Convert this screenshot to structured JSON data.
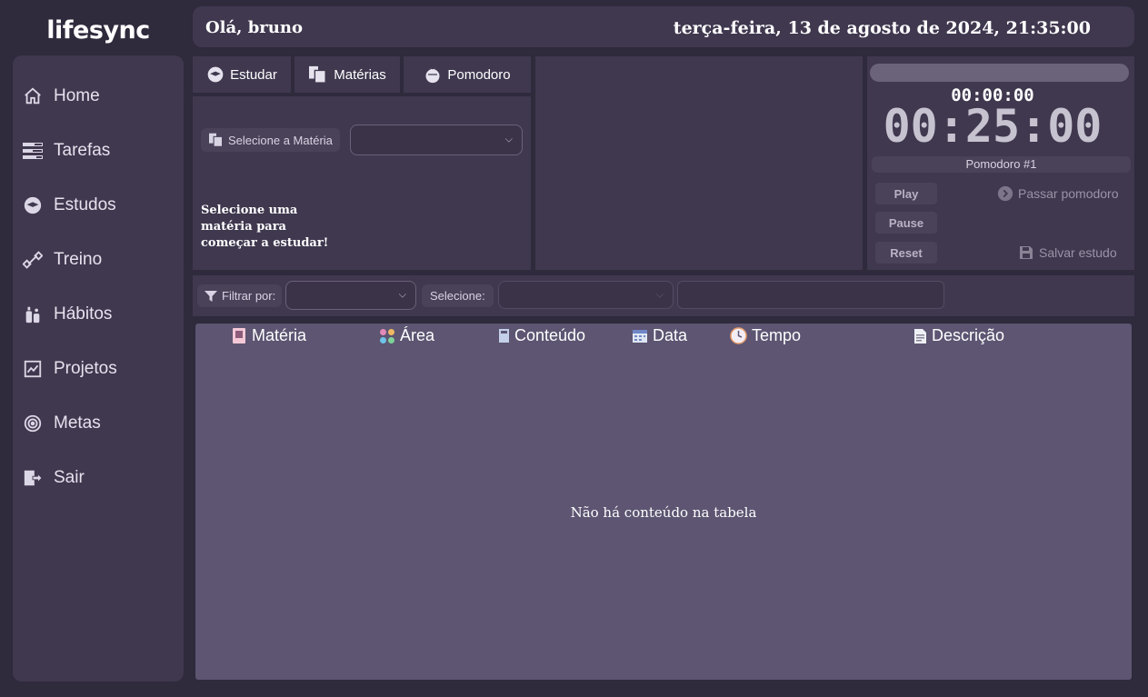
{
  "app": {
    "brand": "lifesync"
  },
  "header": {
    "greeting": "Olá, bruno",
    "datetime": "terça-feira, 13 de agosto de 2024, 21:35:00"
  },
  "sidebar": {
    "items": [
      {
        "label": "Home",
        "icon": "home-icon"
      },
      {
        "label": "Tarefas",
        "icon": "tasks-icon"
      },
      {
        "label": "Estudos",
        "icon": "graduation-cap-icon"
      },
      {
        "label": "Treino",
        "icon": "dumbbell-icon"
      },
      {
        "label": "Hábitos",
        "icon": "habits-icon"
      },
      {
        "label": "Projetos",
        "icon": "chart-board-icon"
      },
      {
        "label": "Metas",
        "icon": "target-icon"
      },
      {
        "label": "Sair",
        "icon": "logout-icon"
      }
    ]
  },
  "study": {
    "tabs": [
      {
        "label": "Estudar",
        "icon": "graduation-cap-icon"
      },
      {
        "label": "Matérias",
        "icon": "books-icon"
      },
      {
        "label": "Pomodoro",
        "icon": "tomato-icon"
      }
    ],
    "select_subject_label": "Selecione a Matéria",
    "select_subject_value": "",
    "empty_message": "Selecione uma matéria para começar a estudar!"
  },
  "pomodoro": {
    "progress": 0,
    "elapsed": "00:00:00",
    "remaining": "00:25:00",
    "label": "Pomodoro #1",
    "play": "Play",
    "pause": "Pause",
    "reset": "Reset",
    "skip": "Passar pomodoro",
    "save": "Salvar estudo"
  },
  "filters": {
    "filter_label": "Filtrar por:",
    "filter_value": "",
    "select_label": "Selecione:",
    "select_value": "",
    "search_value": ""
  },
  "table": {
    "columns": [
      {
        "label": "Matéria",
        "icon": "notebook-icon"
      },
      {
        "label": "Área",
        "icon": "grid-icon"
      },
      {
        "label": "Conteúdo",
        "icon": "book-icon"
      },
      {
        "label": "Data",
        "icon": "calendar-icon"
      },
      {
        "label": "Tempo",
        "icon": "clock-icon"
      },
      {
        "label": "Descrição",
        "icon": "document-icon"
      }
    ],
    "rows": [],
    "empty_message": "Não há conteúdo na tabela"
  },
  "colors": {
    "background": "#2f2a3c",
    "panel": "#40384f",
    "table": "#5d5572"
  }
}
